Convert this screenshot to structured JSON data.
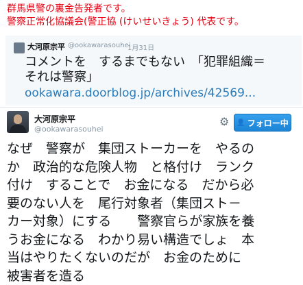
{
  "banner": {
    "line1": "群馬県警の裏金告発者です。",
    "line2": "警察正常化協議会(警正協 (けいせいきょう) 代表です。"
  },
  "quoted": {
    "name": "大河原宗平",
    "handle": "@ookawarasouhei",
    "dot": "·",
    "date": "1月31日",
    "text": "コメントを　するまでもない　「犯罪組織＝\nそれは警察」",
    "link": "ookawara.doorblog.jp/archives/42569..."
  },
  "author": {
    "name": "大河原宗平",
    "handle": "@ookawarasouhei"
  },
  "actions": {
    "follow_label": "フォロー中",
    "gear_icon": "gear-icon",
    "follow_icon": "person-check-icon"
  },
  "tweet": {
    "lines": [
      "なぜ　警察が　集団ストーカーを　やるの",
      "か　政治的な危険人物　と格付け　ランク",
      "付け　することで　お金になる　だから必",
      "要のない人を　尾行対象者（集団スト－",
      "カー対象）にする　　警察官らが家族を養",
      "うお金になる　わかり易い構造でしょ　本",
      "当はやりたくないのだが　お金のために",
      "被害者を造る"
    ]
  },
  "colors": {
    "banner": "#e60012",
    "link": "#2b7bb9",
    "follow_button": "#1b84d6"
  }
}
